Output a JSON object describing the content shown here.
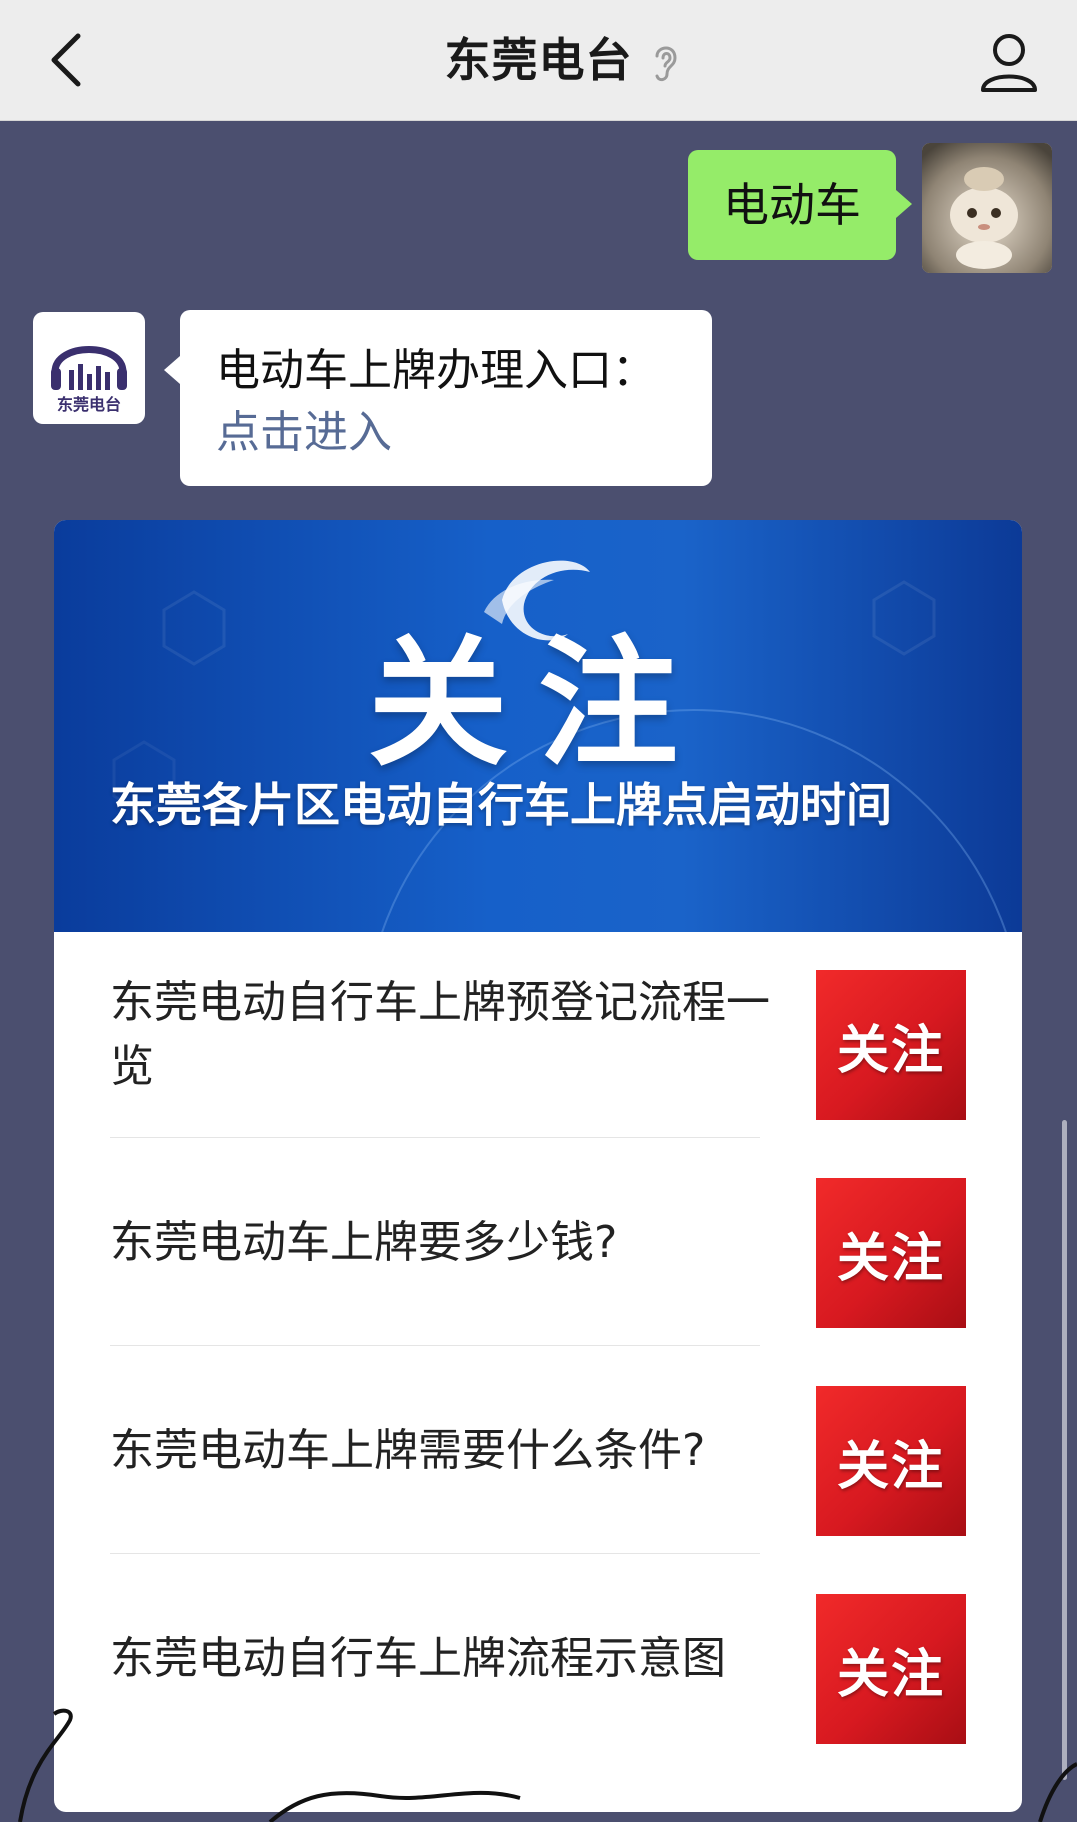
{
  "nav": {
    "title": "东莞电台",
    "back_icon": "chevron-left-icon",
    "ear_icon": "ear-icon",
    "profile_icon": "person-icon"
  },
  "chat": {
    "outgoing": {
      "text": "电动车"
    },
    "incoming": {
      "text": "电动车上牌办理入口：",
      "link": "点击进入",
      "avatar_label": "东莞电台"
    }
  },
  "card": {
    "banner_big": "关注",
    "banner_title": "东莞各片区电动自行车上牌点启动时间",
    "items": [
      {
        "title": "东莞电动自行车上牌预登记流程一览",
        "thumb": "关注"
      },
      {
        "title": "东莞电动车上牌要多少钱?",
        "thumb": "关注"
      },
      {
        "title": "东莞电动车上牌需要什么条件?",
        "thumb": "关注"
      },
      {
        "title": "东莞电动自行车上牌流程示意图",
        "thumb": "关注"
      }
    ]
  },
  "colors": {
    "chat_bg": "#4b4f6f",
    "nav_bg": "#ededed",
    "bubble_out": "#95ec69",
    "link": "#576b95",
    "thumb_red": "#d71920",
    "banner_blue": "#1660c9"
  }
}
